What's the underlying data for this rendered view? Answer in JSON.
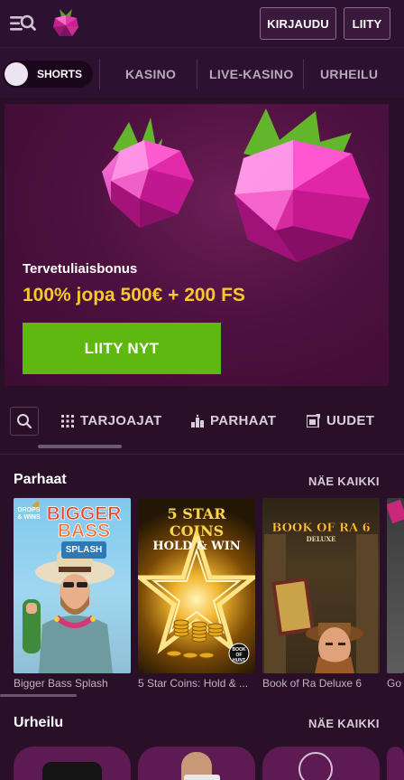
{
  "header": {
    "login_label": "KIRJAUDU",
    "join_label": "LIITY",
    "menu_icon": "menu-search-icon",
    "logo_icon": "raspberry-logo-icon"
  },
  "nav": {
    "shorts_label": "SHORTS",
    "items": [
      "KASINO",
      "LIVE-KASINO",
      "URHEILU"
    ]
  },
  "banner": {
    "welcome": "Tervetuliaisbonus",
    "offer": "100% jopa 500€ + 200 FS",
    "cta": "LIITY NYT"
  },
  "tabs": {
    "items": [
      "TARJOAJAT",
      "PARHAAT",
      "UUDET"
    ]
  },
  "sections": {
    "top": {
      "title": "Parhaat",
      "see_all": "NÄE KAIKKI",
      "games": [
        {
          "name": "Bigger Bass Splash",
          "art_text": [
            "BIGGER",
            "BASS",
            "SPLASH"
          ],
          "badge": "DROPS & WINS"
        },
        {
          "name": "5 Star Coins: Hold & ...",
          "art_text": [
            "5 STAR COINS",
            "HOLD & WIN"
          ],
          "badge": "BOOK OF HUNT"
        },
        {
          "name": "Book of Ra Deluxe 6",
          "art_text": [
            "BOOK OF RA 6",
            "DELUXE"
          ]
        },
        {
          "name": "Go"
        }
      ]
    },
    "sports": {
      "title": "Urheilu",
      "see_all": "NÄE KAIKKI"
    }
  },
  "colors": {
    "background": "#2a0f29",
    "cta_green": "#5fb80f",
    "offer_yellow": "#f6c82a"
  }
}
